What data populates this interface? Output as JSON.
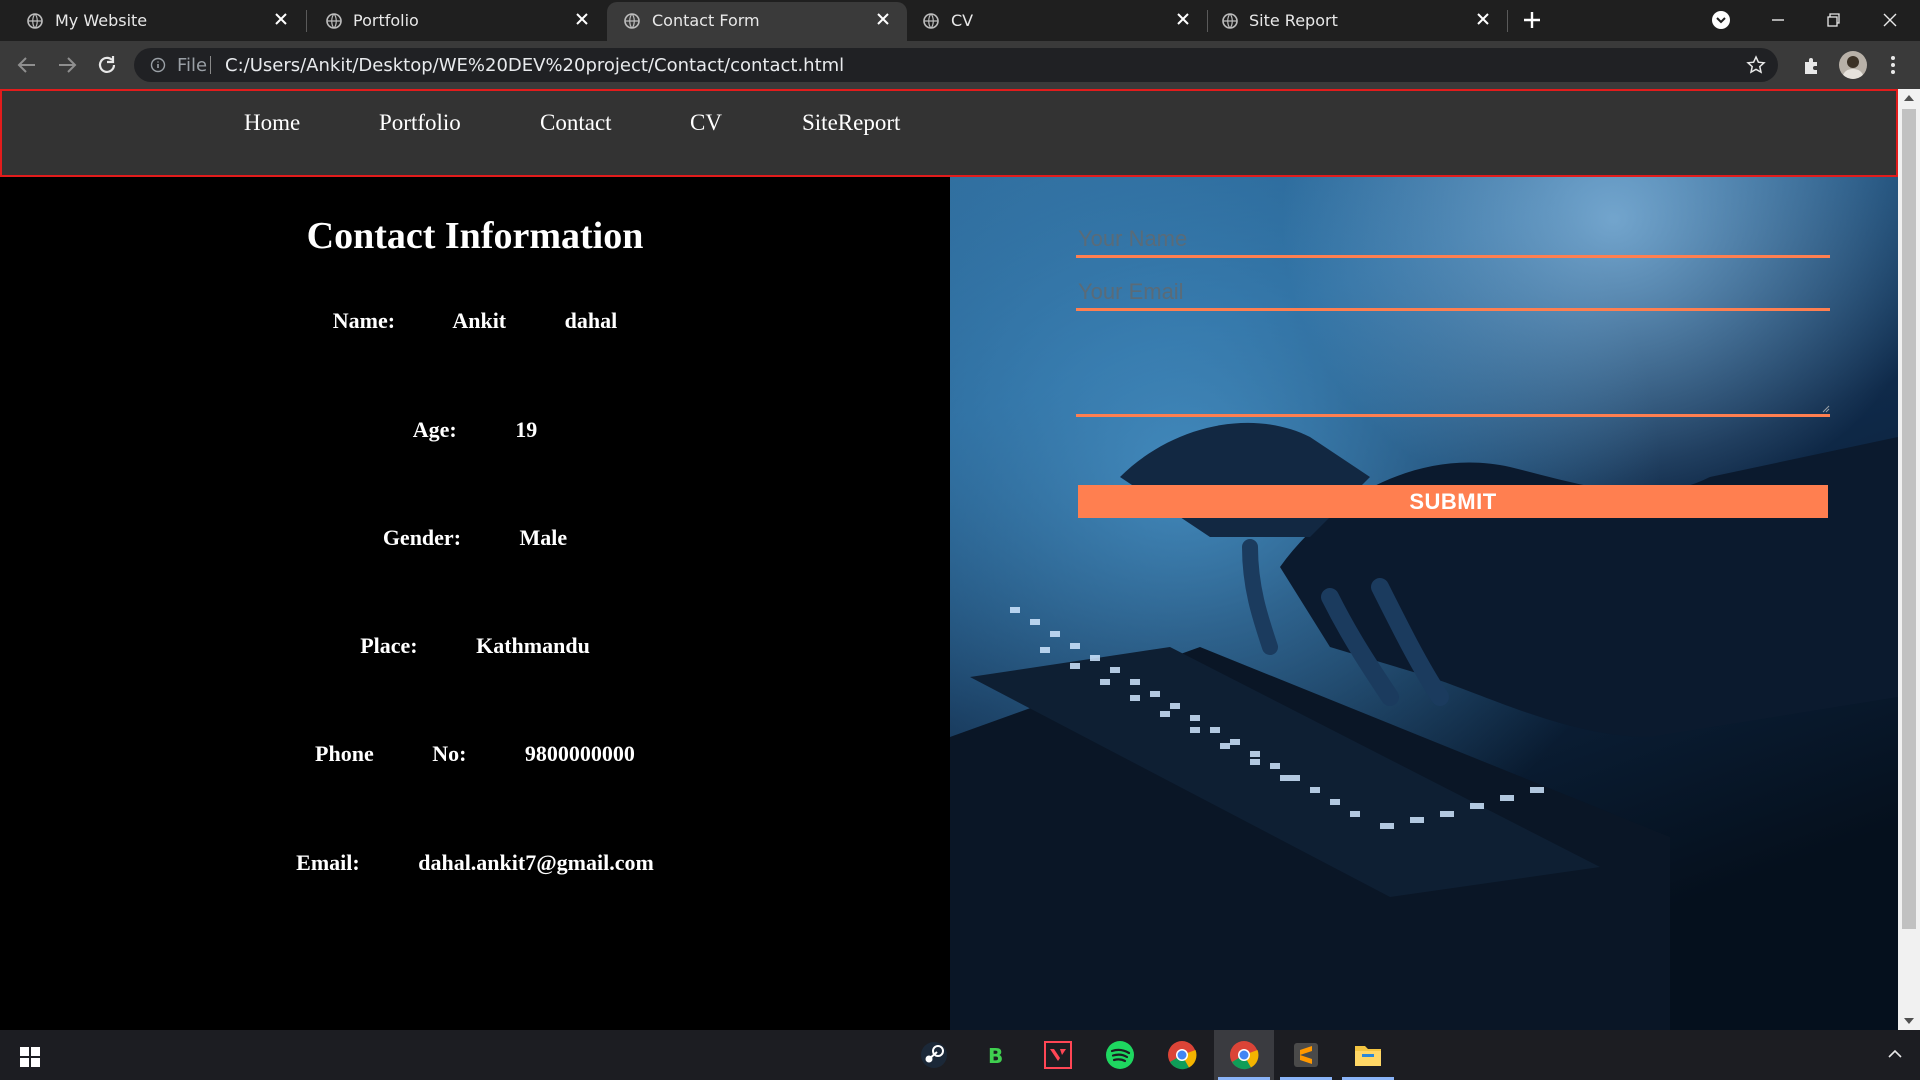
{
  "browser": {
    "tabs": [
      {
        "title": "My Website",
        "active": false
      },
      {
        "title": "Portfolio",
        "active": false
      },
      {
        "title": "Contact Form",
        "active": true
      },
      {
        "title": "CV",
        "active": false
      },
      {
        "title": "Site Report",
        "active": false
      }
    ],
    "address": {
      "scheme_label": "File",
      "url": "C:/Users/Ankit/Desktop/WE%20DEV%20project/Contact/contact.html"
    }
  },
  "site": {
    "nav": [
      "Home",
      "Portfolio",
      "Contact",
      "CV",
      "SiteReport"
    ],
    "contact_info": {
      "title": "Contact Information",
      "rows": [
        "Name:   Ankit   dahal",
        "Age:   19",
        "Gender:   Male",
        "Place:   Kathmandu",
        "Phone   No:   9800000000",
        "Email:   dahal.ankit7@gmail.com"
      ]
    },
    "form": {
      "name_placeholder": "Your Name",
      "email_placeholder": "Your Email",
      "message_value": "",
      "submit_label": "SUBMIT",
      "accent_color": "#ff7f50"
    }
  },
  "taskbar": {
    "apps": [
      "steam-icon",
      "green-b-app-icon",
      "valorant-icon",
      "spotify-icon",
      "chrome-icon",
      "chrome-active-icon",
      "sublime-text-icon",
      "file-explorer-icon"
    ]
  },
  "colors": {
    "nav_bg": "#333333",
    "nav_border": "#e21c1c",
    "page_bg": "#000000"
  }
}
